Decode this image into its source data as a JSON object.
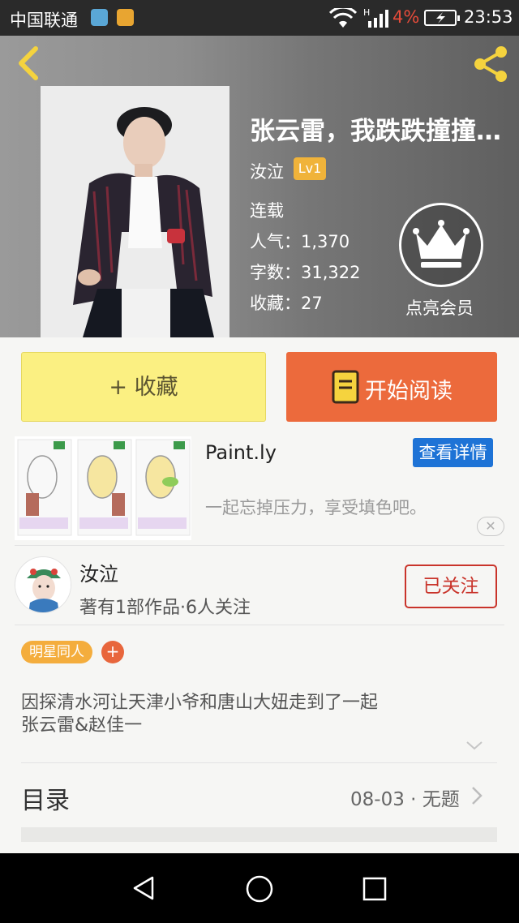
{
  "status_bar": {
    "carrier": "中国联通",
    "battery_percent": "4%",
    "time": "23:53",
    "network_type": "H"
  },
  "book": {
    "title": "张云雷，我跌跌撞撞…",
    "author": "汝泣",
    "level": "Lv1",
    "status": "连载",
    "popularity": "人气：1,370",
    "word_count": "字数：31,322",
    "favorites": "收藏：27",
    "vip_label": "点亮会员"
  },
  "actions": {
    "collect_label": "+ 收藏",
    "read_label": "开始阅读"
  },
  "ad": {
    "title": "Paint.ly",
    "detail_label": "查看详情",
    "description": "一起忘掉压力，享受填色吧。",
    "close_symbol": "✕"
  },
  "author_card": {
    "name": "汝泣",
    "stats": "著有1部作品·6人关注",
    "follow_label": "已关注"
  },
  "tags": {
    "items": [
      "明星同人"
    ],
    "add_symbol": "+"
  },
  "description": {
    "line1": "因探清水河让天津小爷和唐山大妞走到了一起",
    "line2": "张云雷&赵佳一"
  },
  "toc": {
    "label": "目录",
    "latest": "08-03 · 无题"
  },
  "colors": {
    "read_button": "#ec6a3c",
    "collect_button": "#fbf082",
    "follow_border": "#c9342b",
    "detail_button": "#1e73d6",
    "tag": "#f4ad3d",
    "level_badge": "#f0b33a"
  }
}
